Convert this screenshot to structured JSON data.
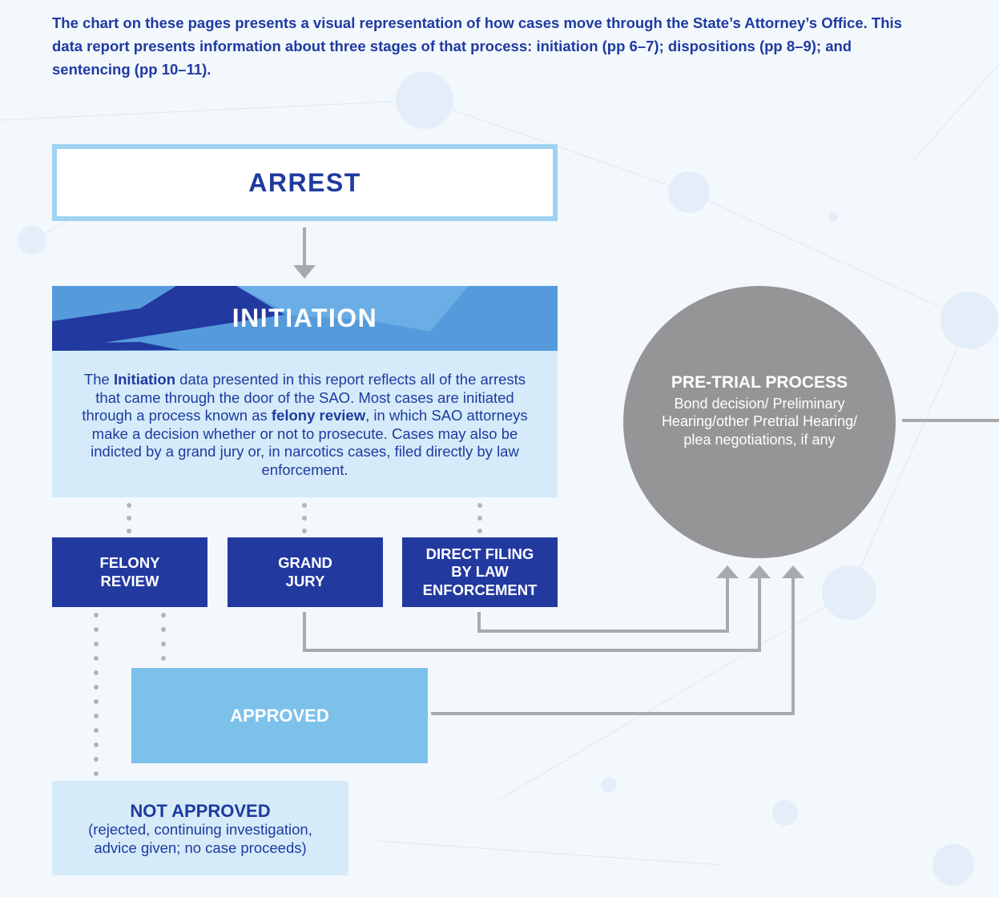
{
  "intro_text": "The chart on these pages presents a visual representation of how cases move through the State’s Attorney’s Office. This data report presents information about three stages of that process: initiation (pp 6–7); dispositions (pp 8–9); and sentencing (pp 10–11).",
  "arrest": {
    "label": "ARREST"
  },
  "initiation": {
    "title": "INITIATION",
    "body": [
      {
        "text": "The ",
        "bold": false
      },
      {
        "text": "Initiation",
        "bold": true
      },
      {
        "text": " data presented in this report reflects all of the arrests that came through the door of the SAO. Most cases are initiated through a process known as ",
        "bold": false
      },
      {
        "text": "felony review",
        "bold": true
      },
      {
        "text": ", in which SAO attorneys make a decision whether or not to prosecute. Cases may also be indicted by a grand jury or, in narcotics cases, filed directly by law enforcement.",
        "bold": false
      }
    ]
  },
  "felony_review": {
    "line1": "FELONY",
    "line2": "REVIEW"
  },
  "grand_jury": {
    "line1": "GRAND",
    "line2": "JURY"
  },
  "direct_filing": {
    "line1": "DIRECT FILING",
    "line2": "BY LAW",
    "line3": "ENFORCEMENT"
  },
  "approved": {
    "label": "APPROVED"
  },
  "not_approved": {
    "title": "NOT APPROVED",
    "line1": "(rejected, continuing investigation,",
    "line2": "advice given; no case proceeds)"
  },
  "pretrial": {
    "title": "PRE-TRIAL PROCESS",
    "line1": "Bond decision/ Preliminary",
    "line2": "Hearing/other Pretrial Hearing/",
    "line3": "plea negotiations, if any"
  },
  "colors": {
    "dark_blue": "#2239a0",
    "mid_blue": "#559bdc",
    "light_blue": "#7cc1ea",
    "pale_blue": "#d5ebf9",
    "arrest_border": "#9fd3f1",
    "gray": "#959597",
    "connector_gray": "#a9aaac"
  }
}
